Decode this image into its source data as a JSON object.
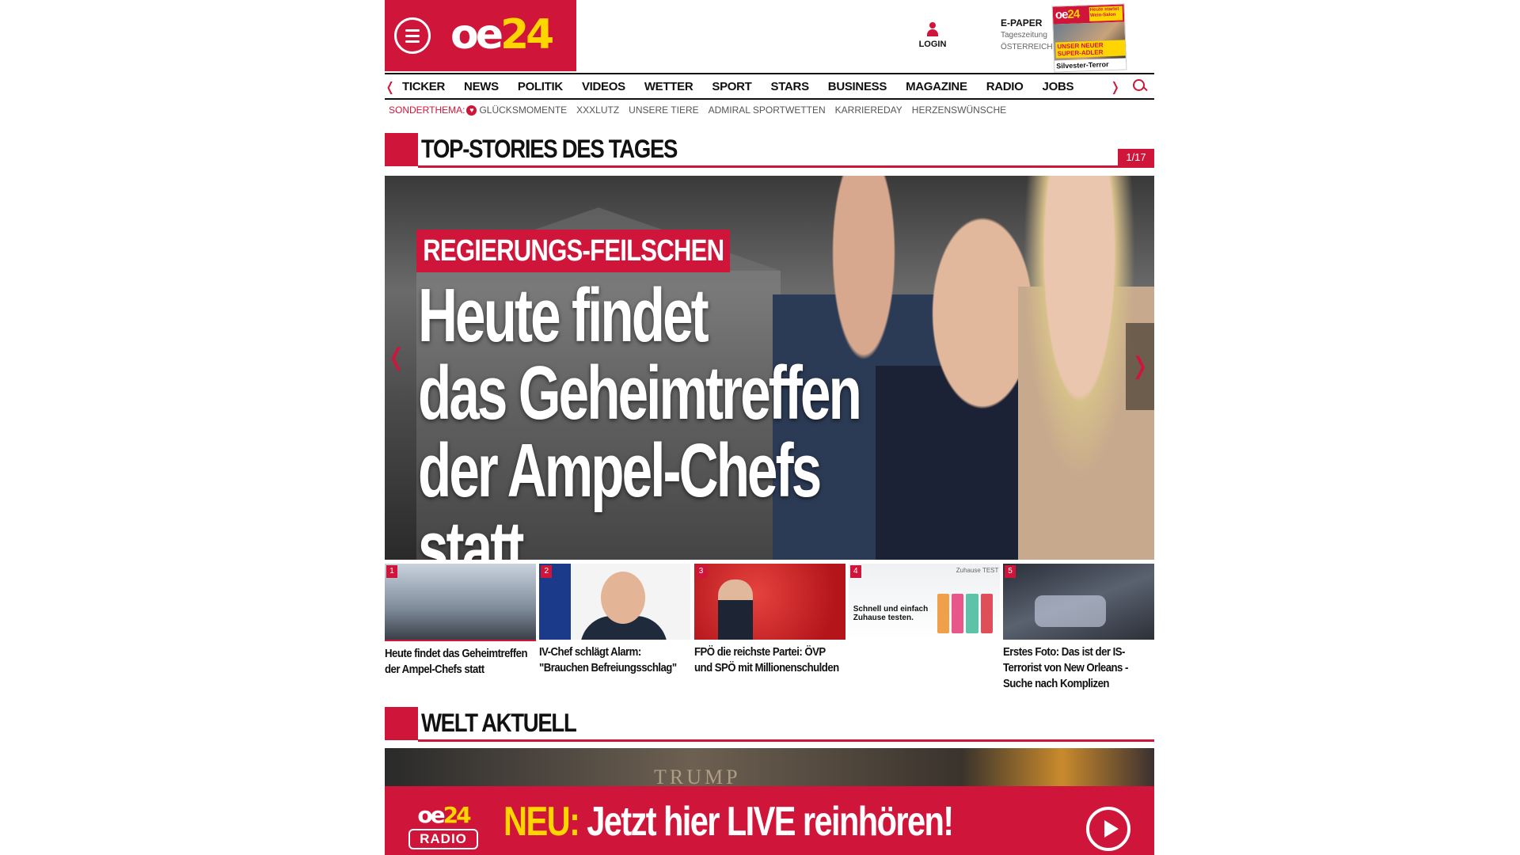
{
  "header": {
    "logo_oe": "oe",
    "logo_num": "24",
    "login_label": "LOGIN",
    "epaper_title": "E-PAPER",
    "epaper_sub1": "Tageszeitung",
    "epaper_sub2": "ÖSTERREICH",
    "epaper_cover_side": "Heute startet Wein-Salon",
    "epaper_cover_badge": "UNSER NEUER SUPER-ADLER",
    "epaper_cover_footer": "Silvester-Terror"
  },
  "nav": {
    "items": [
      "TICKER",
      "NEWS",
      "POLITIK",
      "VIDEOS",
      "WETTER",
      "SPORT",
      "STARS",
      "BUSINESS",
      "MAGAZINE",
      "RADIO",
      "JOBS"
    ]
  },
  "subnav": {
    "lead": "SONDERTHEMA:",
    "items": [
      "GLÜCKSMOMENTE",
      "XXXLUTZ",
      "UNSERE TIERE",
      "ADMIRAL SPORTWETTEN",
      "KARRIEREDAY",
      "HERZENSWÜNSCHE"
    ]
  },
  "top_stories": {
    "title": "TOP-STORIES DES TAGES",
    "counter": "1/17"
  },
  "hero": {
    "kicker": "REGIERUNGS-FEILSCHEN",
    "headline_line1": "Heute findet",
    "headline_line2": "das Geheimtreffen",
    "headline_line3": "der Ampel-Chefs statt"
  },
  "cards": [
    {
      "num": "1",
      "title": "Heute findet das Geheimtreffen der Ampel-Chefs statt"
    },
    {
      "num": "2",
      "title": "IV-Chef schlägt Alarm: \"Brauchen Befreiungsschlag\""
    },
    {
      "num": "3",
      "title": "FPÖ die reichste Partei: ÖVP und SPÖ mit Millionenschulden"
    },
    {
      "num": "4",
      "title": "",
      "ad_text": "Schnell und einfach Zuhause testen.",
      "ad_brand": "Zuhause TEST"
    },
    {
      "num": "5",
      "title": "Erstes Foto: Das ist der IS-Terrorist von New Orleans - Suche nach Komplizen"
    }
  ],
  "welt": {
    "title": "WELT AKTUELL",
    "teaser_sign": "TRUMP"
  },
  "radio": {
    "logo_oe": "oe",
    "logo_num": "24",
    "logo_label": "RADIO",
    "neu": "NEU:",
    "message": "Jetzt hier LIVE reinhören!"
  },
  "colors": {
    "brand_red": "#d0153a",
    "brand_yellow": "#ffd500"
  }
}
